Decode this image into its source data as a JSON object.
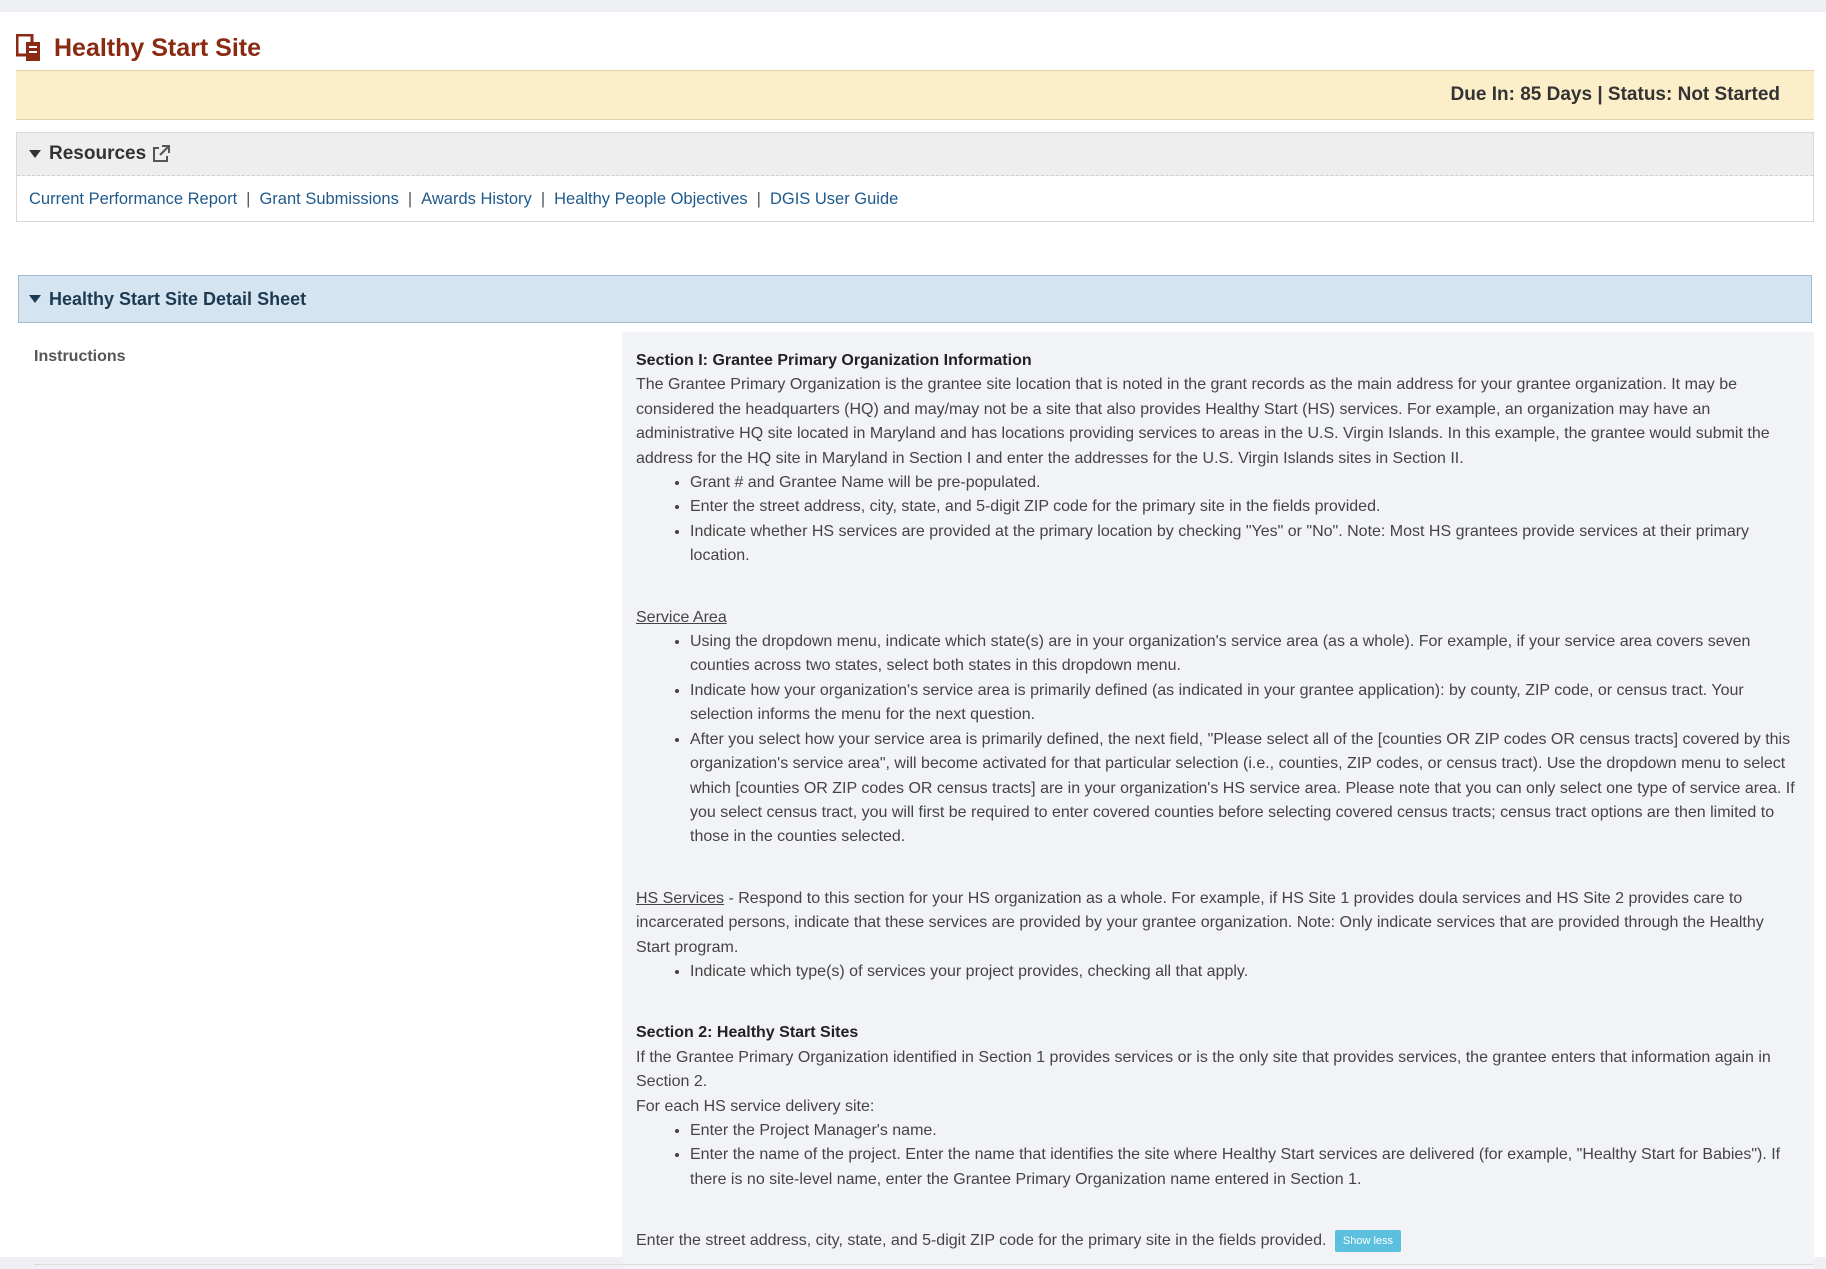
{
  "header": {
    "title": "Healthy Start Site",
    "status_text": "Due In: 85 Days | Status: Not Started"
  },
  "resources": {
    "title": "Resources",
    "links": [
      "Current Performance Report",
      "Grant Submissions",
      "Awards History",
      "Healthy People Objectives",
      "DGIS User Guide"
    ],
    "separator": "|"
  },
  "detail_sheet": {
    "title": "Healthy Start Site Detail Sheet",
    "instructions_label": "Instructions"
  },
  "instructions": {
    "section1_heading": "Section I: Grantee Primary Organization Information",
    "section1_para": "The Grantee Primary Organization is the grantee site location that is noted in the grant records as the main address for your grantee organization. It may be considered the headquarters (HQ) and may/may not be a site that also provides Healthy Start (HS) services. For example, an organization may have an administrative HQ site located in Maryland and has locations providing services to areas in the U.S. Virgin Islands. In this example, the grantee would submit the address for the HQ site in Maryland in Section I and enter the addresses for the U.S. Virgin Islands sites in Section II.",
    "section1_bullets": [
      "Grant # and Grantee Name will be pre-populated.",
      "Enter the street address, city, state, and 5-digit ZIP code for the primary site in the fields provided.",
      "Indicate whether HS services are provided at the primary location by checking \"Yes\" or \"No\". Note: Most HS grantees provide services at their primary location."
    ],
    "service_area_heading": "Service Area",
    "service_area_bullets": [
      "Using the dropdown menu, indicate which state(s) are in your organization's service area (as a whole). For example, if your service area covers seven counties across two states, select both states in this dropdown menu.",
      "Indicate how your organization's service area is primarily defined (as indicated in your grantee application): by county, ZIP code, or census tract. Your selection informs the menu for the next question.",
      "After you select how your service area is primarily defined, the next field, \"Please select all of the [counties OR ZIP codes OR census tracts] covered by this organization's service area\", will become activated for that particular selection (i.e., counties, ZIP codes, or census tract). Use the dropdown menu to select which [counties OR ZIP codes OR census tracts] are in your organization's HS service area. Please note that you can only select one type of service area. If you select census tract, you will first be required to enter covered counties before selecting covered census tracts; census tract options are then limited to those in the counties selected."
    ],
    "hs_services_heading": "HS Services",
    "hs_services_para": " - Respond to this section for your HS organization as a whole. For example, if HS Site 1 provides doula services and HS Site 2 provides care to incarcerated persons, indicate that these services are provided by your grantee organization. Note: Only indicate services that are provided through the Healthy Start program.",
    "hs_services_bullets": [
      "Indicate which type(s) of services your project provides, checking all that apply."
    ],
    "section2_heading": "Section 2: Healthy Start Sites",
    "section2_para1": "If the Grantee Primary Organization identified in Section 1 provides services or is the only site that provides services, the grantee enters that information again in Section 2.",
    "section2_para2": "For each HS service delivery site:",
    "section2_bullets": [
      "Enter the Project Manager's name.",
      "Enter the name of the project. Enter the name that identifies the site where Healthy Start services are delivered (for example, \"Healthy Start for Babies\"). If there is no site-level name, enter the Grantee Primary Organization name entered in Section 1."
    ],
    "final_para": "Enter the street address, city, state, and 5-digit ZIP code for the primary site in the fields provided.",
    "show_less_label": "Show less"
  }
}
